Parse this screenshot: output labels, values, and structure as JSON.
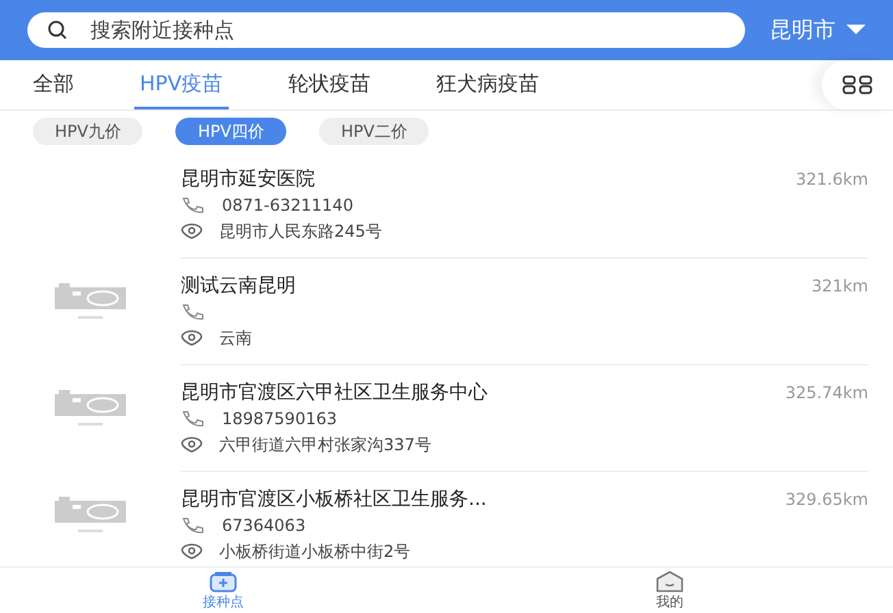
{
  "search": {
    "placeholder": "搜索附近接种点"
  },
  "city": {
    "label": "昆明市"
  },
  "tabs": [
    {
      "label": "全部",
      "selected": false
    },
    {
      "label": "HPV疫苗",
      "selected": true
    },
    {
      "label": "轮状疫苗",
      "selected": false
    },
    {
      "label": "狂犬病疫苗",
      "selected": false
    }
  ],
  "chips": [
    {
      "label": "HPV九价",
      "selected": false
    },
    {
      "label": "HPV四价",
      "selected": true
    },
    {
      "label": "HPV二价",
      "selected": false
    }
  ],
  "sites": [
    {
      "name": "昆明市延安医院",
      "distance": "321.6km",
      "phone": "0871-63211140",
      "address": "昆明市人民东路245号",
      "placeholder_image": false
    },
    {
      "name": "测试云南昆明",
      "distance": "321km",
      "address": "云南",
      "placeholder_image": true
    },
    {
      "name": "昆明市官渡区六甲社区卫生服务中心",
      "distance": "325.74km",
      "phone": "18987590163",
      "address": "六甲街道六甲村张家沟337号",
      "placeholder_image": true
    },
    {
      "name": "昆明市官渡区小板桥社区卫生服务...",
      "distance": "329.65km",
      "phone": "67364063",
      "address": "小板桥街道小板桥中街2号",
      "placeholder_image": true
    }
  ],
  "bottom_nav": [
    {
      "label": "接种点",
      "selected": true,
      "kind": "clinic"
    },
    {
      "label": "我的",
      "selected": false,
      "kind": "profile"
    }
  ]
}
